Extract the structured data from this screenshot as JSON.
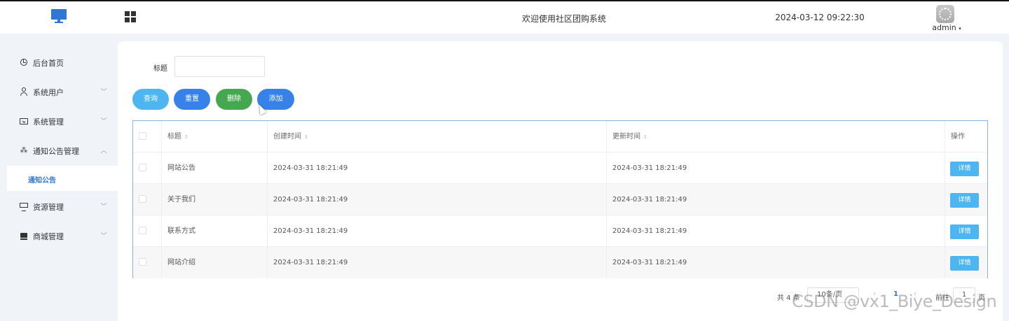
{
  "header": {
    "title": "欢迎使用社区团购系统",
    "datetime": "2024-03-12 09:22:30",
    "user": "admin",
    "caret": "▾"
  },
  "sidebar": {
    "items": [
      {
        "label": "后台首页",
        "icon": "dashboard-icon"
      },
      {
        "label": "系统用户",
        "icon": "user-icon",
        "chevron": "﹀"
      },
      {
        "label": "系统管理",
        "icon": "folder-icon",
        "chevron": "﹀"
      },
      {
        "label": "通知公告管理",
        "icon": "sparkle-icon",
        "chevron": "︿"
      },
      {
        "label": "资源管理",
        "icon": "monitor-icon",
        "chevron": "﹀"
      },
      {
        "label": "商城管理",
        "icon": "shop-icon",
        "chevron": "﹀"
      }
    ],
    "active_sub": "通知公告"
  },
  "filter": {
    "title_label": "标题",
    "title_value": ""
  },
  "actions": {
    "query": "查询",
    "reset": "重置",
    "delete": "删除",
    "add": "添加"
  },
  "table": {
    "headers": [
      "标题",
      "创建时间",
      "更新时间",
      "操作"
    ],
    "sort_glyph": "⇕",
    "detail_label": "详情",
    "rows": [
      {
        "title": "网站公告",
        "created": "2024-03-31 18:21:49",
        "updated": "2024-03-31 18:21:49"
      },
      {
        "title": "关于我们",
        "created": "2024-03-31 18:21:49",
        "updated": "2024-03-31 18:21:49"
      },
      {
        "title": "联系方式",
        "created": "2024-03-31 18:21:49",
        "updated": "2024-03-31 18:21:49"
      },
      {
        "title": "网站介绍",
        "created": "2024-03-31 18:21:49",
        "updated": "2024-03-31 18:21:49"
      }
    ]
  },
  "pagination": {
    "total": "共 4 条",
    "page_size": "10条/页",
    "prev": "‹",
    "current": "1",
    "next": "›",
    "goto_label": "前往",
    "goto_value": "1",
    "page_suffix": "页"
  },
  "watermark": "CSDN @vx1_Biye_Design",
  "colors": {
    "primary": "#3682e8",
    "info": "#4db6f0",
    "success": "#45a850",
    "active_text": "#2f76d6"
  }
}
